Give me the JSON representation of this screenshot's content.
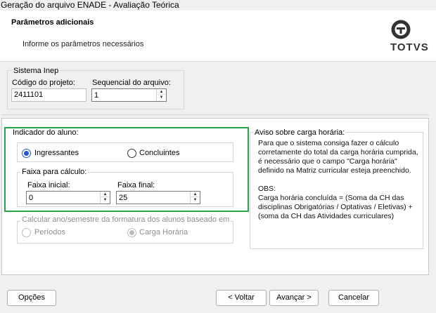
{
  "window": {
    "title": "Geração do arquivo ENADE - Avaliação Teórica"
  },
  "header": {
    "title": "Parâmetros adicionais",
    "subtitle": "Informe os parâmetros necessários",
    "logo_text": "TOTVS"
  },
  "sistema_inep": {
    "legend": "Sistema Inep",
    "codigo_label": "Código do projeto:",
    "codigo_value": "2411101",
    "sequencial_label": "Sequencial do arquivo:",
    "sequencial_value": "1"
  },
  "indicador": {
    "legend": "Indicador do aluno:",
    "ingressantes_label": "Ingressantes",
    "concluintes_label": "Concluintes",
    "selected": "Ingressantes"
  },
  "faixa": {
    "legend": "Faixa para cálculo:",
    "inicial_label": "Faixa inicial:",
    "inicial_value": "0",
    "final_label": "Faixa final:",
    "final_value": "25"
  },
  "calcular": {
    "legend": "Calcular ano/semestre da formatura dos alunos baseado em",
    "periodos_label": "Períodos",
    "carga_label": "Carga Horária",
    "selected": "Carga Horária"
  },
  "aviso": {
    "legend": "Aviso sobre carga horária:",
    "lines": [
      "Para que o sistema consiga fazer o cálculo",
      "corretamente do total da carga horária cumprida,",
      "é necessário que o campo \"Carga horária\"",
      "definido na Matriz curricular esteja preenchido.",
      "",
      "OBS:",
      "Carga horária concluída = (Soma da CH das",
      "disciplinas Obrigatórias / Optativas / Eletivas) +",
      "(soma da CH das Atividades curriculares)"
    ]
  },
  "buttons": {
    "opcoes": "Opções",
    "voltar": "< Voltar",
    "avancar": "Avançar >",
    "cancelar": "Cancelar"
  }
}
